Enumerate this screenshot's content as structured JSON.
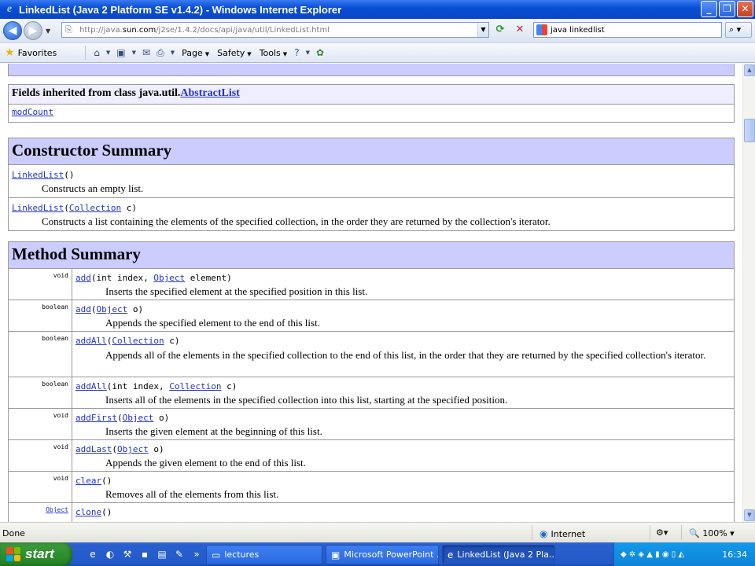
{
  "window": {
    "title": "LinkedList (Java 2 Platform SE v1.4.2) - Windows Internet Explorer",
    "minimize": "_",
    "maximize": "❐",
    "close": "✕"
  },
  "address": {
    "url_prefix": "http://java.",
    "url_domain": "sun.com",
    "url_rest": "/j2se/1.4.2/docs/api/java/util/LinkedList.html"
  },
  "search": {
    "value": "java linkedlist"
  },
  "commandbar": {
    "favorites": "Favorites",
    "page": "Page",
    "safety": "Safety",
    "tools": "Tools"
  },
  "page": {
    "inherited_fields": {
      "heading_prefix": "Fields inherited from class java.util.",
      "heading_link": "AbstractList",
      "fields": "modCount"
    },
    "constructor_summary": {
      "title": "Constructor Summary",
      "rows": [
        {
          "name": "LinkedList",
          "params_open": "()",
          "param_type": "",
          "param_rest": "",
          "desc": "Constructs an empty list."
        },
        {
          "name": "LinkedList",
          "params_open": "(",
          "param_type": "Collection",
          "param_rest": " c)",
          "desc": "Constructs a list containing the elements of the specified collection, in the order they are returned by the collection's iterator."
        }
      ]
    },
    "method_summary": {
      "title": "Method Summary",
      "rows": [
        {
          "type": "void",
          "name": "add",
          "sig_pre": "(int index, ",
          "sig_type": "Object",
          "sig_post": " element)",
          "desc": "Inserts the specified element at the specified position in this list."
        },
        {
          "type": "boolean",
          "name": "add",
          "sig_pre": "(",
          "sig_type": "Object",
          "sig_post": " o)",
          "desc": "Appends the specified element to the end of this list."
        },
        {
          "type": "boolean",
          "name": "addAll",
          "sig_pre": "(",
          "sig_type": "Collection",
          "sig_post": " c)",
          "desc": "Appends all of the elements in the specified collection to the end of this list, in the order that they are returned by the specified collection's iterator."
        },
        {
          "type": "boolean",
          "name": "addAll",
          "sig_pre": "(int index, ",
          "sig_type": "Collection",
          "sig_post": " c)",
          "desc": "Inserts all of the elements in the specified collection into this list, starting at the specified position."
        },
        {
          "type": "void",
          "name": "addFirst",
          "sig_pre": "(",
          "sig_type": "Object",
          "sig_post": " o)",
          "desc": "Inserts the given element at the beginning of this list."
        },
        {
          "type": "void",
          "name": "addLast",
          "sig_pre": "(",
          "sig_type": "Object",
          "sig_post": " o)",
          "desc": "Appends the given element to the end of this list."
        },
        {
          "type": "void",
          "name": "clear",
          "sig_pre": "()",
          "sig_type": "",
          "sig_post": "",
          "desc": "Removes all of the elements from this list."
        },
        {
          "type": "Object",
          "name": "clone",
          "sig_pre": "()",
          "sig_type": "",
          "sig_post": "",
          "desc": ""
        }
      ]
    }
  },
  "status": {
    "text": "Done",
    "zone": "Internet",
    "zoom": "100%"
  },
  "taskbar": {
    "start": "start",
    "buttons": [
      {
        "label": "lectures"
      },
      {
        "label": "Microsoft PowerPoint ..."
      },
      {
        "label": "LinkedList (Java 2 Pla..."
      }
    ],
    "clock": "16:34"
  },
  "colors": {
    "header_band": "#ccccff",
    "inherited_band": "#eeeeff",
    "link": "#2233cc"
  }
}
